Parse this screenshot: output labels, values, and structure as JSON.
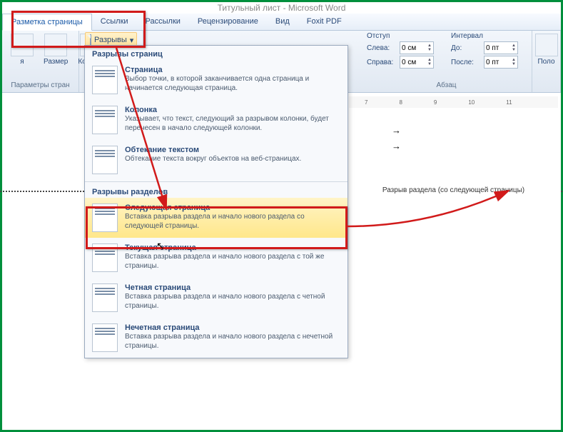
{
  "app_title": "Титульный лист - Microsoft Word",
  "tabs": [
    "Разметка страницы",
    "Ссылки",
    "Рассылки",
    "Рецензирование",
    "Вид",
    "Foxit PDF"
  ],
  "ribbon": {
    "big_buttons": [
      "я",
      "Размер",
      "Колонки"
    ],
    "group1_label": "Параметры стран",
    "breaks_label": "Разрывы",
    "indent": {
      "header": "Отступ",
      "left_label": "Слева:",
      "left_value": "0 см",
      "right_label": "Справа:",
      "right_value": "0 см"
    },
    "interval": {
      "header": "Интервал",
      "before_label": "До:",
      "before_value": "0 пт",
      "after_label": "После:",
      "after_value": "0 пт"
    },
    "group2_label": "Абзац",
    "right_label": "Поло"
  },
  "dropdown": {
    "section1": "Разрывы страниц",
    "items1": [
      {
        "title": "Страница",
        "desc": "Выбор точки, в которой заканчивается одна страница и начинается следующая страница."
      },
      {
        "title": "Колонка",
        "desc": "Указывает, что текст, следующий за разрывом колонки, будет перенесен в начало следующей колонки."
      },
      {
        "title": "Обтекание текстом",
        "desc": "Обтекание текста вокруг объектов на веб-страницах."
      }
    ],
    "section2": "Разрывы разделов",
    "items2": [
      {
        "title": "Следующая страница",
        "desc": "Вставка разрыва раздела и начало нового раздела со следующей страницы."
      },
      {
        "title": "Текущая страница",
        "desc": "Вставка разрыва раздела и начало нового раздела с той же страницы."
      },
      {
        "title": "Четная страница",
        "desc": "Вставка разрыва раздела и начало нового раздела с четной страницы."
      },
      {
        "title": "Нечетная страница",
        "desc": "Вставка разрыва раздела и начало нового раздела с нечетной страницы."
      }
    ]
  },
  "doc": {
    "section_break_label": "Разрыв раздела (со следующей страницы)"
  },
  "ruler_marks": [
    "7",
    "8",
    "9",
    "10",
    "11"
  ],
  "colors": {
    "highlight": "#d11a1a",
    "frame": "#008f3c"
  }
}
